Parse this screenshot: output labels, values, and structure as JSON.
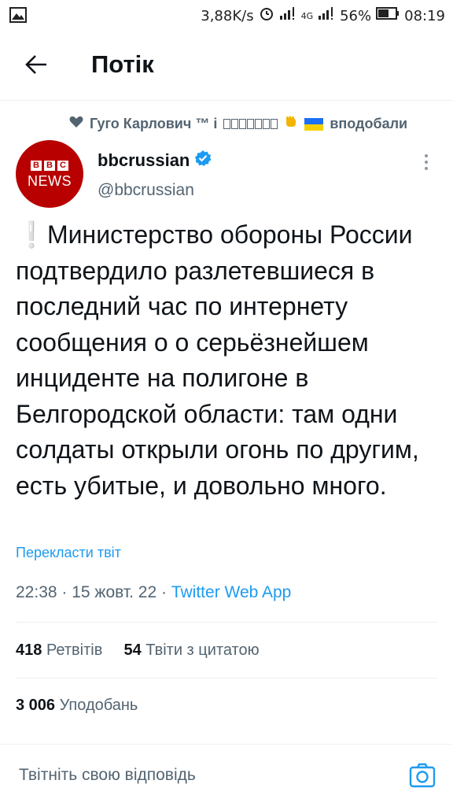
{
  "status_bar": {
    "speed": "3,88K/s",
    "network": "4G",
    "battery": "56%",
    "time": "08:19"
  },
  "header": {
    "title": "Потік"
  },
  "social_context": {
    "liker_name": "Гуго Карлович ™ і",
    "suffix": "вподобали"
  },
  "tweet": {
    "display_name": "bbcrussian",
    "handle": "@bbcrussian",
    "avatar_top": "BBC",
    "avatar_bottom": "NEWS",
    "exclamation": "❕",
    "text": "Министерство обороны России подтвердило разлетевшиеся в последний час по интернету сообщения о о серьёзнейшем инциденте на полигоне в Белгородской области: там одни солдаты открыли огонь по другим, есть убитые, и довольно много.",
    "translate_label": "Перекласти твіт",
    "time": "22:38",
    "date": "15 жовт. 22",
    "source": "Twitter Web App",
    "retweets_count": "418",
    "retweets_label": "Ретвітів",
    "quotes_count": "54",
    "quotes_label": "Твіти з цитатою",
    "likes_count": "3 006",
    "likes_label": "Уподобань"
  },
  "reply": {
    "placeholder": "Твітніть свою відповідь"
  },
  "colors": {
    "accent": "#1d9bf0",
    "text_primary": "#0f1419",
    "text_secondary": "#536471",
    "bbc_red": "#b80000"
  }
}
